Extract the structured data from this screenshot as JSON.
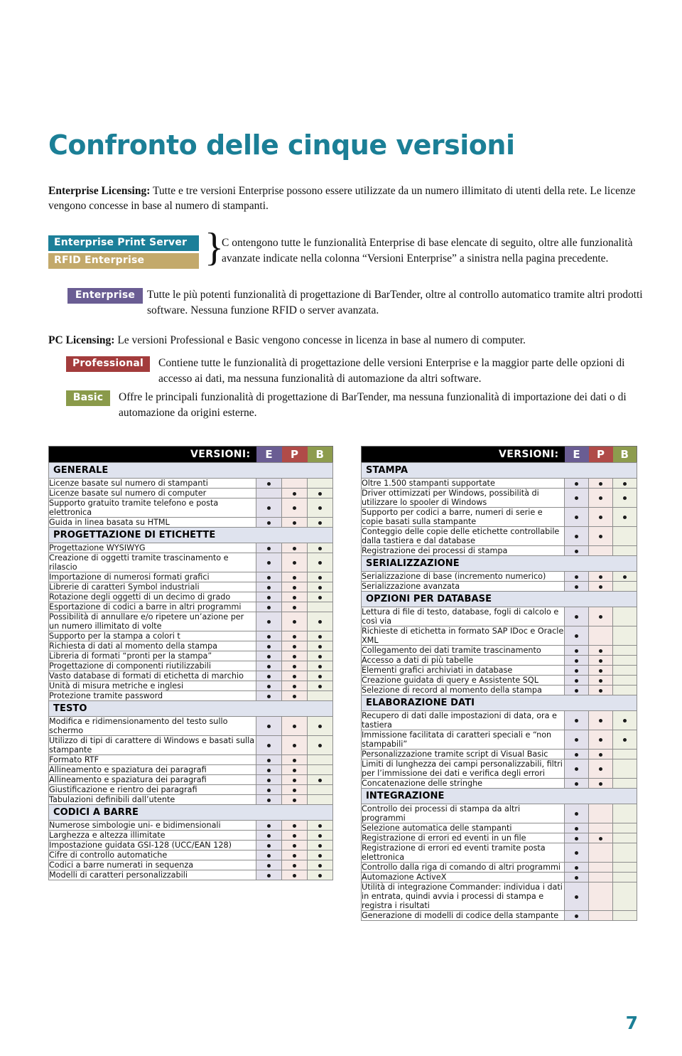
{
  "page": {
    "title": "Confronto delle cinque versioni",
    "page_number": "7",
    "accent_color": "#1b7f96"
  },
  "intro": {
    "enterprise_licensing_label": "Enterprise Licensing:",
    "enterprise_licensing_text": " Tutte e tre versioni Enterprise possono essere utilizzate da un numero illimitato di utenti della rete. Le licenze vengono concesse in base al numero di stampanti.",
    "pc_licensing_label": "PC Licensing:",
    "pc_licensing_text": " Le versioni Professional e Basic vengono concesse in licenza in base al numero di computer."
  },
  "badges": {
    "enterprise_print_server": {
      "label": "Enterprise Print Server",
      "color": "#1c7f99"
    },
    "rfid_enterprise": {
      "label": "RFID Enterprise",
      "color": "#c3a96b"
    },
    "enterprise": {
      "label": "Enterprise",
      "color": "#6a5d93"
    },
    "professional": {
      "label": "Professional",
      "color": "#a33c3c"
    },
    "basic": {
      "label": "Basic",
      "color": "#8a9a4a"
    }
  },
  "descriptions": {
    "eps_rfid": "C ontengono tutte le funzionalità Enterprise di base elencate di seguito, oltre alle funzionalità avanzate indicate nella colonna “Versioni Enterprise” a sinistra nella pagina precedente.",
    "enterprise": "Tutte le più potenti funzionalità di progettazione di BarTender, oltre al controllo automatico tramite altri prodotti software. Nessuna funzione RFID o server avanzata.",
    "professional": "Contiene tutte le funzionalità di progettazione delle versioni Enterprise e la maggior parte delle opzioni di accesso ai dati, ma nessuna funzionalità di automazione da altri software.",
    "basic": "Offre le principali funzionalità di progettazione di BarTender, ma nessuna funzionalità di importazione dei dati o di automazione da origini esterne."
  },
  "table_header": {
    "versions_label": "VERSIONI:",
    "columns": [
      "E",
      "P",
      "B"
    ],
    "column_colors": [
      "#6a5d93",
      "#b04b48",
      "#8d9c4e"
    ]
  },
  "left_table": [
    {
      "type": "section",
      "label": "GENERALE"
    },
    {
      "type": "row",
      "label": "Licenze basate sul numero di stampanti",
      "e": true,
      "p": false,
      "b": false
    },
    {
      "type": "row",
      "label": "Licenze basate sul numero di computer",
      "e": false,
      "p": true,
      "b": true
    },
    {
      "type": "row",
      "label": "Supporto gratuito tramite telefono e posta elettronica",
      "e": true,
      "p": true,
      "b": true
    },
    {
      "type": "row",
      "label": "Guida in linea basata su HTML",
      "e": true,
      "p": true,
      "b": true
    },
    {
      "type": "section",
      "label": "PROGETTAZIONE DI ETICHETTE"
    },
    {
      "type": "row",
      "label": "Progettazione WYSIWYG",
      "e": true,
      "p": true,
      "b": true
    },
    {
      "type": "row",
      "label": "Creazione di oggetti tramite trascinamento e rilascio",
      "e": true,
      "p": true,
      "b": true
    },
    {
      "type": "row",
      "label": "Importazione di numerosi formati grafici",
      "e": true,
      "p": true,
      "b": true
    },
    {
      "type": "row",
      "label": "Librerie di caratteri Symbol industriali",
      "e": true,
      "p": true,
      "b": true
    },
    {
      "type": "row",
      "label": "Rotazione degli oggetti di un decimo di grado",
      "e": true,
      "p": true,
      "b": true
    },
    {
      "type": "row",
      "label": "Esportazione di codici a barre in altri programmi",
      "e": true,
      "p": true,
      "b": false
    },
    {
      "type": "row",
      "label": "Possibilità di annullare e/o ripetere un’azione per un numero illimitato di volte",
      "e": true,
      "p": true,
      "b": true
    },
    {
      "type": "row",
      "label": "Supporto per la stampa a colori t",
      "e": true,
      "p": true,
      "b": true
    },
    {
      "type": "row",
      "label": "Richiesta di dati al momento della stampa",
      "e": true,
      "p": true,
      "b": true
    },
    {
      "type": "row",
      "label": "Libreria di formati “pronti per la stampa”",
      "e": true,
      "p": true,
      "b": true
    },
    {
      "type": "row",
      "label": "Progettazione di componenti riutilizzabili",
      "e": true,
      "p": true,
      "b": true
    },
    {
      "type": "row",
      "label": "Vasto database di formati di etichetta di marchio",
      "e": true,
      "p": true,
      "b": true
    },
    {
      "type": "row",
      "label": "Unità di misura metriche e inglesi",
      "e": true,
      "p": true,
      "b": true
    },
    {
      "type": "row",
      "label": "Protezione tramite password",
      "e": true,
      "p": true,
      "b": false
    },
    {
      "type": "section",
      "label": "TESTO"
    },
    {
      "type": "row",
      "label": "Modifica e ridimensionamento del testo sullo schermo",
      "e": true,
      "p": true,
      "b": true
    },
    {
      "type": "row",
      "label": "Utilizzo di tipi di carattere di Windows e basati sulla stampante",
      "e": true,
      "p": true,
      "b": true
    },
    {
      "type": "row",
      "label": "Formato RTF",
      "e": true,
      "p": true,
      "b": false
    },
    {
      "type": "row",
      "label": "Allineamento e spaziatura dei paragrafi",
      "e": true,
      "p": true,
      "b": false
    },
    {
      "type": "row",
      "label": "Allineamento e spaziatura dei paragrafi",
      "e": true,
      "p": true,
      "b": true
    },
    {
      "type": "row",
      "label": "Giustificazione e rientro dei paragrafi",
      "e": true,
      "p": true,
      "b": false
    },
    {
      "type": "row",
      "label": "Tabulazioni definibili dall’utente",
      "e": true,
      "p": true,
      "b": false
    },
    {
      "type": "section",
      "label": "CODICI A BARRE"
    },
    {
      "type": "row",
      "label": "Numerose simbologie uni- e bidimensionali",
      "e": true,
      "p": true,
      "b": true
    },
    {
      "type": "row",
      "label": "Larghezza e altezza illimitate",
      "e": true,
      "p": true,
      "b": true
    },
    {
      "type": "row",
      "label": "Impostazione guidata GSI-128 (UCC/EAN 128)",
      "e": true,
      "p": true,
      "b": true
    },
    {
      "type": "row",
      "label": "Cifre di controllo automatiche",
      "e": true,
      "p": true,
      "b": true
    },
    {
      "type": "row",
      "label": "Codici a barre numerati in sequenza",
      "e": true,
      "p": true,
      "b": true
    },
    {
      "type": "row",
      "label": "Modelli di caratteri personalizzabili",
      "e": true,
      "p": true,
      "b": true
    }
  ],
  "right_table": [
    {
      "type": "section",
      "label": "STAMPA"
    },
    {
      "type": "row",
      "label": "Oltre 1.500 stampanti supportate",
      "e": true,
      "p": true,
      "b": true
    },
    {
      "type": "row",
      "label": "Driver ottimizzati per Windows, possibilità di utilizzare lo spooler di Windows",
      "e": true,
      "p": true,
      "b": true
    },
    {
      "type": "row",
      "label": "Supporto per codici a barre, numeri di serie e copie basati sulla stampante",
      "e": true,
      "p": true,
      "b": true
    },
    {
      "type": "row",
      "label": "Conteggio delle copie delle etichette controllabile dalla tastiera e dal database",
      "e": true,
      "p": true,
      "b": false
    },
    {
      "type": "row",
      "label": "Registrazione dei processi di stampa",
      "e": true,
      "p": false,
      "b": false
    },
    {
      "type": "section",
      "label": "SERIALIZZAZIONE"
    },
    {
      "type": "row",
      "label": "Serializzazione di base (incremento numerico)",
      "e": true,
      "p": true,
      "b": true
    },
    {
      "type": "row",
      "label": "Serializzazione avanzata",
      "e": true,
      "p": true,
      "b": false
    },
    {
      "type": "section",
      "label": "OPZIONI PER DATABASE"
    },
    {
      "type": "row",
      "label": "Lettura di file di testo, database, fogli di calcolo e così via",
      "e": true,
      "p": true,
      "b": false
    },
    {
      "type": "row",
      "label": "Richieste di etichetta in formato SAP IDoc e Oracle XML",
      "e": true,
      "p": false,
      "b": false
    },
    {
      "type": "row",
      "label": "Collegamento dei dati tramite trascinamento",
      "e": true,
      "p": true,
      "b": false
    },
    {
      "type": "row",
      "label": "Accesso a dati di più tabelle",
      "e": true,
      "p": true,
      "b": false
    },
    {
      "type": "row",
      "label": "Elementi grafici archiviati in database",
      "e": true,
      "p": true,
      "b": false
    },
    {
      "type": "row",
      "label": "Creazione guidata di query e Assistente SQL",
      "e": true,
      "p": true,
      "b": false
    },
    {
      "type": "row",
      "label": "Selezione di record al momento della stampa",
      "e": true,
      "p": true,
      "b": false
    },
    {
      "type": "section",
      "label": "ELABORAZIONE DATI"
    },
    {
      "type": "row",
      "label": "Recupero di dati dalle impostazioni di data, ora e tastiera",
      "e": true,
      "p": true,
      "b": true
    },
    {
      "type": "row",
      "label": "Immissione facilitata di caratteri speciali e “non stampabili”",
      "e": true,
      "p": true,
      "b": true
    },
    {
      "type": "row",
      "label": "Personalizzazione tramite script di Visual Basic",
      "e": true,
      "p": true,
      "b": false
    },
    {
      "type": "row",
      "label": "Limiti di lunghezza dei campi personalizzabili, filtri per l’immissione dei dati e verifica degli errori",
      "e": true,
      "p": true,
      "b": false
    },
    {
      "type": "row",
      "label": "Concatenazione delle stringhe",
      "e": true,
      "p": true,
      "b": false
    },
    {
      "type": "section",
      "label": "INTEGRAZIONE"
    },
    {
      "type": "row",
      "label": "Controllo dei processi di stampa da altri programmi",
      "e": true,
      "p": false,
      "b": false
    },
    {
      "type": "row",
      "label": "Selezione automatica delle stampanti",
      "e": true,
      "p": false,
      "b": false
    },
    {
      "type": "row",
      "label": "Registrazione di errori ed eventi in un file",
      "e": true,
      "p": true,
      "b": false
    },
    {
      "type": "row",
      "label": "Registrazione di errori ed eventi tramite posta elettronica",
      "e": true,
      "p": false,
      "b": false
    },
    {
      "type": "row",
      "label": "Controllo dalla riga di comando di altri programmi",
      "e": true,
      "p": false,
      "b": false
    },
    {
      "type": "row",
      "label": "Automazione ActiveX",
      "e": true,
      "p": false,
      "b": false
    },
    {
      "type": "row",
      "label": "Utilità di integrazione Commander:  individua i dati in entrata, quindi avvia i processi di stampa e registra i risultati",
      "e": true,
      "p": false,
      "b": false
    },
    {
      "type": "row",
      "label": "Generazione di modelli di codice della stampante",
      "e": true,
      "p": false,
      "b": false
    }
  ]
}
